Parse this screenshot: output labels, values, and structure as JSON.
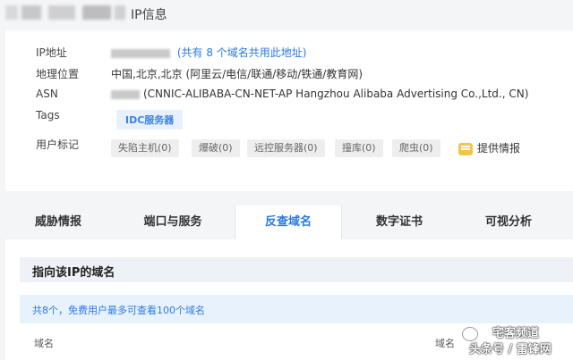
{
  "header": {
    "title": "IP信息"
  },
  "info": {
    "ip_label": "IP地址",
    "ip_note": "(共有 8 个域名共用此地址)",
    "location_label": "地理位置",
    "location_value": "中国,北京,北京 (阿里云/电信/联通/移动/铁通/教育网)",
    "asn_label": "ASN",
    "asn_value": "(CNNIC-ALIBABA-CN-NET-AP Hangzhou Alibaba Advertising Co.,Ltd., CN)",
    "tags_label": "Tags",
    "tag": "IDC服务器",
    "user_mark_label": "用户标记",
    "marks": [
      "失陷主机(0)",
      "爆破(0)",
      "远控服务器(0)",
      "撞库(0)",
      "爬虫(0)"
    ],
    "report_label": "提供情报"
  },
  "tabs": [
    "威胁情报",
    "端口与服务",
    "反查域名",
    "数字证书",
    "可视分析"
  ],
  "active_tab": "反查域名",
  "domains": {
    "section_title": "指向该IP的域名",
    "notice": "共8个，免费用户最多可查看100个域名",
    "col1": "域名",
    "col2": "域名"
  },
  "watermark": {
    "line1": "宅客频道",
    "line2": "头条号 / 雷锋网"
  }
}
